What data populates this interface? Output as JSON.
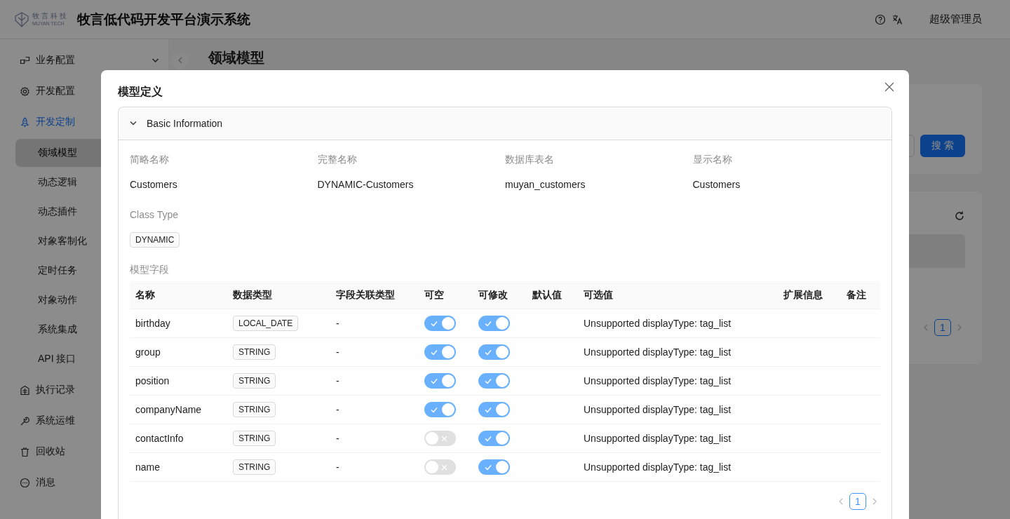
{
  "header": {
    "logo_name": "牧言科技",
    "logo_subtitle": "MUYAN TECH",
    "app_title": "牧言低代码开发平台演示系统",
    "user": "超级管理员"
  },
  "sidebar": {
    "items": [
      {
        "label": "业务配置",
        "selected": false,
        "expandable": true
      },
      {
        "label": "开发配置",
        "selected": false
      },
      {
        "label": "开发定制",
        "selected": true,
        "children": [
          {
            "label": "领域模型",
            "selected": true
          },
          {
            "label": "动态逻辑",
            "selected": false
          },
          {
            "label": "动态插件",
            "selected": false
          },
          {
            "label": "对象客制化",
            "selected": false
          },
          {
            "label": "定时任务",
            "selected": false
          },
          {
            "label": "对象动作",
            "selected": false
          },
          {
            "label": "系统集成",
            "selected": false
          },
          {
            "label": "API 接口",
            "selected": false
          }
        ]
      },
      {
        "label": "执行记录",
        "selected": false
      },
      {
        "label": "系统运维",
        "selected": false
      },
      {
        "label": "回收站",
        "selected": false
      },
      {
        "label": "消息",
        "selected": false
      }
    ]
  },
  "main": {
    "page_title": "领域模型",
    "search_button": "搜 索",
    "pagination": [
      {
        "label": "1",
        "selected": true
      }
    ]
  },
  "modal": {
    "title": "模型定义",
    "panel": {
      "title": "Basic Information",
      "expanded": true,
      "fields": [
        {
          "label": "简略名称",
          "value": "Customers"
        },
        {
          "label": "完整名称",
          "value": "DYNAMIC-Customers"
        },
        {
          "label": "数据库表名",
          "value": "muyan_customers"
        },
        {
          "label": "显示名称",
          "value": "Customers"
        }
      ],
      "class_type": {
        "label": "Class Type",
        "tag": "DYNAMIC"
      },
      "fields_label": "模型字段",
      "table": {
        "columns": [
          "名称",
          "数据类型",
          "字段关联类型",
          "可空",
          "可修改",
          "默认值",
          "可选值",
          "扩展信息",
          "备注"
        ],
        "rows": [
          {
            "name": "birthday",
            "data_type": "LOCAL_DATE",
            "relation": "-",
            "nullable": true,
            "editable": true,
            "options": "Unsupported displayType: tag_list"
          },
          {
            "name": "group",
            "data_type": "STRING",
            "relation": "-",
            "nullable": true,
            "editable": true,
            "options": "Unsupported displayType: tag_list"
          },
          {
            "name": "position",
            "data_type": "STRING",
            "relation": "-",
            "nullable": true,
            "editable": true,
            "options": "Unsupported displayType: tag_list"
          },
          {
            "name": "companyName",
            "data_type": "STRING",
            "relation": "-",
            "nullable": true,
            "editable": true,
            "options": "Unsupported displayType: tag_list"
          },
          {
            "name": "contactInfo",
            "data_type": "STRING",
            "relation": "-",
            "nullable": false,
            "editable": true,
            "options": "Unsupported displayType: tag_list"
          },
          {
            "name": "name",
            "data_type": "STRING",
            "relation": "-",
            "nullable": false,
            "editable": true,
            "options": "Unsupported displayType: tag_list"
          }
        ]
      },
      "pagination": [
        {
          "label": "1",
          "selected": true
        }
      ]
    }
  }
}
